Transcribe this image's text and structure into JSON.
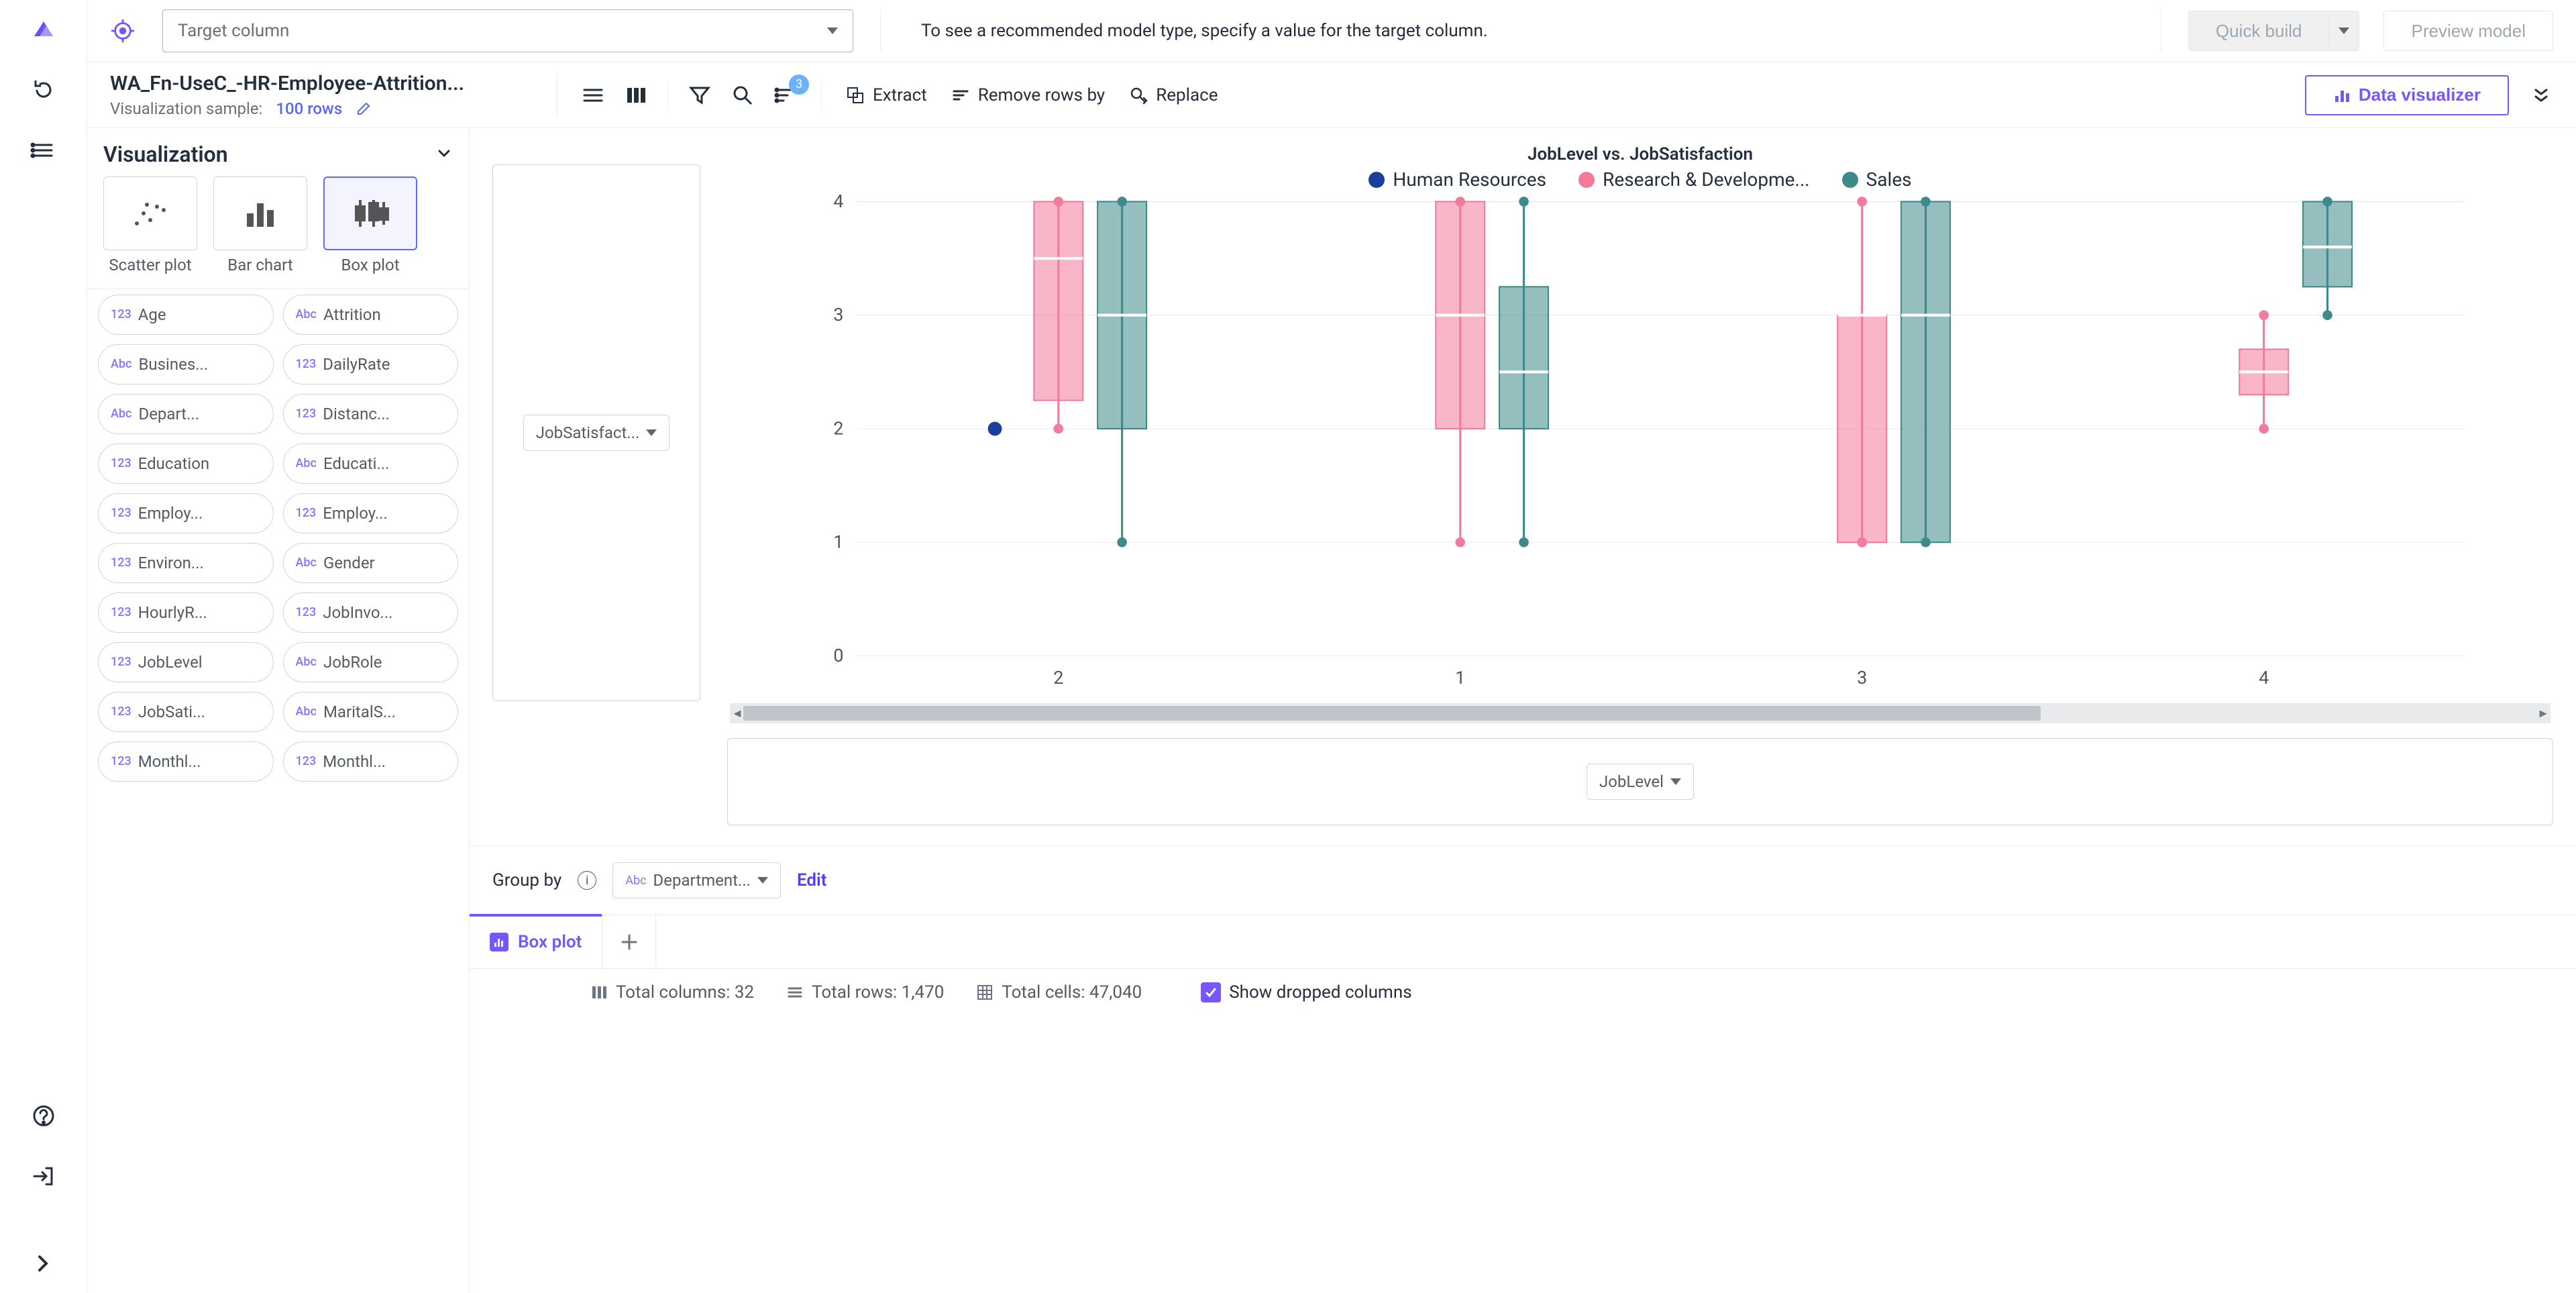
{
  "topbar": {
    "target_placeholder": "Target column",
    "hint": "To see a recommended model type, specify a value for the target column.",
    "quick_build": "Quick build",
    "preview_model": "Preview model"
  },
  "ctx": {
    "title": "WA_Fn-UseC_-HR-Employee-Attrition...",
    "sample_label": "Visualization sample:",
    "sample_value": "100 rows",
    "extract": "Extract",
    "remove_rows": "Remove rows by",
    "replace": "Replace",
    "data_visualizer": "Data visualizer",
    "sort_badge": "3"
  },
  "viz": {
    "heading": "Visualization",
    "types": {
      "scatter": "Scatter plot",
      "bar": "Bar chart",
      "box": "Box plot"
    }
  },
  "columns": [
    {
      "t": "123",
      "n": "Age"
    },
    {
      "t": "Abc",
      "n": "Attrition"
    },
    {
      "t": "Abc",
      "n": "Busines..."
    },
    {
      "t": "123",
      "n": "DailyRate"
    },
    {
      "t": "Abc",
      "n": "Depart..."
    },
    {
      "t": "123",
      "n": "Distanc..."
    },
    {
      "t": "123",
      "n": "Education"
    },
    {
      "t": "Abc",
      "n": "Educati..."
    },
    {
      "t": "123",
      "n": "Employ..."
    },
    {
      "t": "123",
      "n": "Employ..."
    },
    {
      "t": "123",
      "n": "Environ..."
    },
    {
      "t": "Abc",
      "n": "Gender"
    },
    {
      "t": "123",
      "n": "HourlyR..."
    },
    {
      "t": "123",
      "n": "JobInvo..."
    },
    {
      "t": "123",
      "n": "JobLevel"
    },
    {
      "t": "Abc",
      "n": "JobRole"
    },
    {
      "t": "123",
      "n": "JobSati..."
    },
    {
      "t": "Abc",
      "n": "MaritalS..."
    },
    {
      "t": "123",
      "n": "Monthl..."
    },
    {
      "t": "123",
      "n": "Monthl..."
    }
  ],
  "axes": {
    "y": "JobSatisfact...",
    "x": "JobLevel"
  },
  "group": {
    "label": "Group by",
    "value": "Department...",
    "type": "Abc",
    "edit": "Edit"
  },
  "legend": {
    "hr": "Human Resources",
    "rd": "Research & Developme...",
    "sales": "Sales"
  },
  "chart_title": "JobLevel vs. JobSatisfaction",
  "status": {
    "total_cols": "Total columns: 32",
    "total_rows": "Total rows: 1,470",
    "total_cells": "Total cells: 47,040",
    "show_dropped": "Show dropped columns"
  },
  "tabs": {
    "boxplot": "Box plot"
  },
  "chart_data": {
    "type": "box",
    "xlabel": "JobLevel",
    "ylabel": "JobSatisfaction",
    "title": "JobLevel vs. JobSatisfaction",
    "categories": [
      "2",
      "1",
      "3",
      "4"
    ],
    "ylim": [
      0,
      4
    ],
    "series": [
      {
        "name": "Human Resources",
        "color": "#1c3f9f",
        "boxes": [
          {
            "cat": "2",
            "q1": 2,
            "median": 2,
            "q3": 2,
            "lo": 2,
            "hi": 2,
            "type": "point"
          }
        ]
      },
      {
        "name": "Research & Development",
        "color": "#f27a9a",
        "boxes": [
          {
            "cat": "2",
            "q1": 2.25,
            "median": 3.5,
            "q3": 4,
            "lo": 2,
            "hi": 4
          },
          {
            "cat": "1",
            "q1": 2,
            "median": 3,
            "q3": 4,
            "lo": 1,
            "hi": 4
          },
          {
            "cat": "3",
            "q1": 1,
            "median": 3,
            "q3": 3,
            "lo": 1,
            "hi": 4
          },
          {
            "cat": "4",
            "q1": 2.3,
            "median": 2.5,
            "q3": 2.7,
            "lo": 2,
            "hi": 3
          }
        ]
      },
      {
        "name": "Sales",
        "color": "#3e8a8a",
        "boxes": [
          {
            "cat": "2",
            "q1": 2,
            "median": 3,
            "q3": 4,
            "lo": 1,
            "hi": 4
          },
          {
            "cat": "1",
            "q1": 2,
            "median": 2.5,
            "q3": 3.25,
            "lo": 1,
            "hi": 4
          },
          {
            "cat": "3",
            "q1": 1,
            "median": 3,
            "q3": 4,
            "lo": 1,
            "hi": 4
          },
          {
            "cat": "4",
            "q1": 3.25,
            "median": 3.6,
            "q3": 4,
            "lo": 3,
            "hi": 4
          }
        ]
      }
    ]
  }
}
